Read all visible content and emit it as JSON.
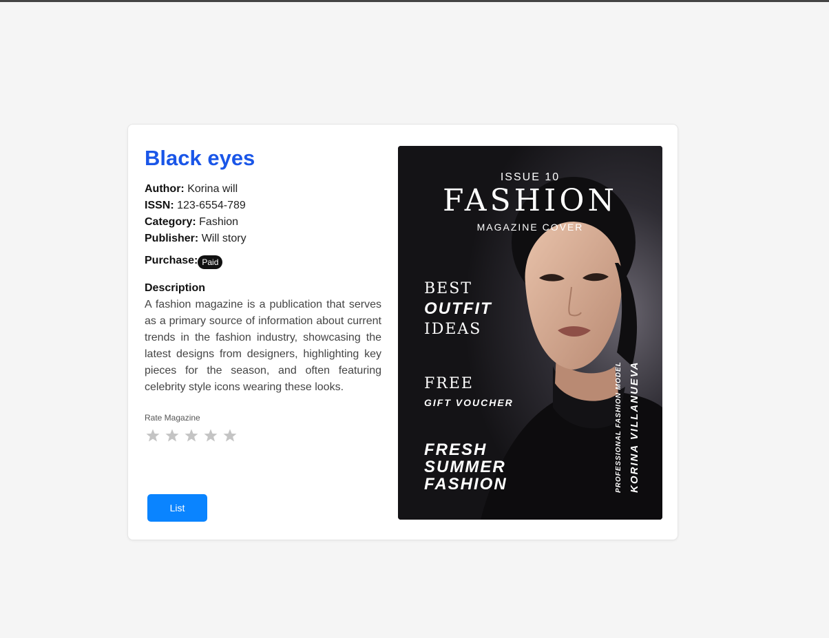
{
  "magazine": {
    "title": "Black eyes",
    "author_label": "Author:",
    "author": "Korina will",
    "issn_label": "ISSN:",
    "issn": "123-6554-789",
    "category_label": "Category:",
    "category": "Fashion",
    "publisher_label": "Publisher:",
    "publisher": "Will story",
    "purchase_label": "Purchase:",
    "purchase_badge": "Paid",
    "description_heading": "Description",
    "description": "A fashion magazine is a publication that serves as a primary source of information about current trends in the fashion industry, showcasing the latest designs from designers, highlighting key pieces for the season, and often featuring celebrity style icons wearing these looks."
  },
  "rating": {
    "label": "Rate Magazine",
    "value": 0,
    "max": 5,
    "star_icon": "star-icon"
  },
  "actions": {
    "list_label": "List"
  },
  "cover": {
    "issue": "ISSUE 10",
    "masthead": "FASHION",
    "masthead_sub": "MAGAZINE COVER",
    "line1": "BEST",
    "line2": "OUTFIT",
    "line3": "IDEAS",
    "line4": "FREE",
    "line5": "GIFT VOUCHER",
    "line6": "FRESH",
    "line7": "SUMMER",
    "line8": "FASHION",
    "vertical_small": "PROFESSIONAL FASHION MODEL",
    "vertical_name": "KORINA VILLANUEVA"
  },
  "colors": {
    "title": "#1a56e8",
    "button": "#0a84ff",
    "badge": "#111111",
    "star_inactive": "#c4c4c4"
  }
}
